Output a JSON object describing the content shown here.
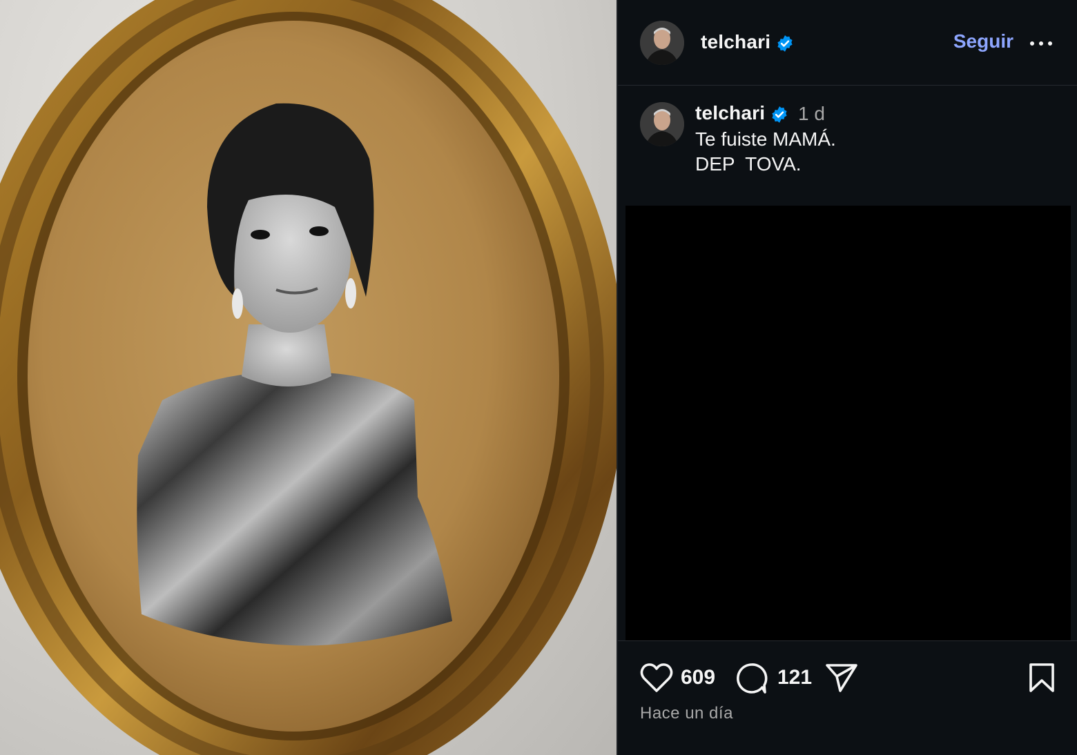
{
  "post": {
    "username": "telchari",
    "follow_label": "Seguir",
    "more_icon": "more-horizontal-icon",
    "verified_icon": "verified-badge-icon",
    "accent_color": "#8ea6ff",
    "verified_color": "#0095f6"
  },
  "comment": {
    "username": "telchari",
    "time": "1 d",
    "caption_line1": "Te fuiste MAMÁ.",
    "caption_line2": "DEP  TOVA."
  },
  "actions": {
    "like_icon": "heart-icon",
    "likes_count": "609",
    "comment_icon": "comment-icon",
    "comments_count": "121",
    "share_icon": "send-icon",
    "save_icon": "bookmark-icon"
  },
  "timestamp": "Hace un día"
}
